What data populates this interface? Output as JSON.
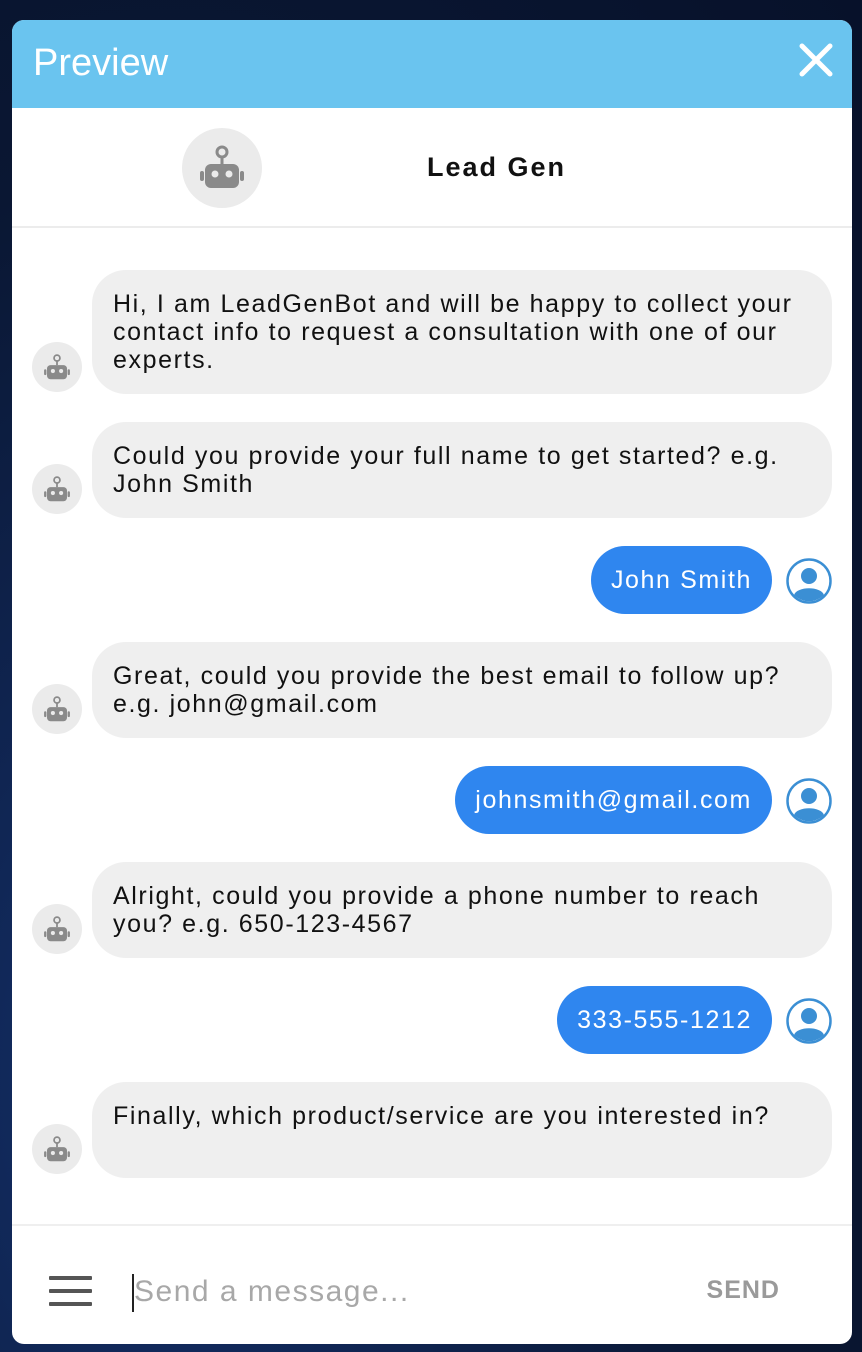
{
  "window": {
    "title": "Preview",
    "close_icon": "close-icon"
  },
  "header": {
    "bot_name": "Lead Gen",
    "avatar_icon": "robot-icon"
  },
  "messages": [
    {
      "sender": "bot",
      "text": "Hi, I am LeadGenBot and will be happy to collect your contact info to request a consultation with one of our experts."
    },
    {
      "sender": "bot",
      "text": "Could you provide your full name to get started? e.g. John Smith"
    },
    {
      "sender": "user",
      "text": "John Smith"
    },
    {
      "sender": "bot",
      "text": "Great, could you provide the best email to follow up? e.g. john@gmail.com"
    },
    {
      "sender": "user",
      "text": "johnsmith@gmail.com"
    },
    {
      "sender": "bot",
      "text": "Alright, could you provide a phone number to reach you? e.g. 650-123-4567"
    },
    {
      "sender": "user",
      "text": "333-555-1212"
    },
    {
      "sender": "bot",
      "text": "Finally, which product/service are you interested in?"
    }
  ],
  "composer": {
    "placeholder": "Send a message...",
    "value": "",
    "send_label": "SEND",
    "menu_icon": "menu-icon"
  },
  "colors": {
    "titlebar": "#6ac4ef",
    "user_bubble": "#2f86ef",
    "bot_bubble": "#efefef",
    "user_avatar": "#3b8fd4"
  }
}
